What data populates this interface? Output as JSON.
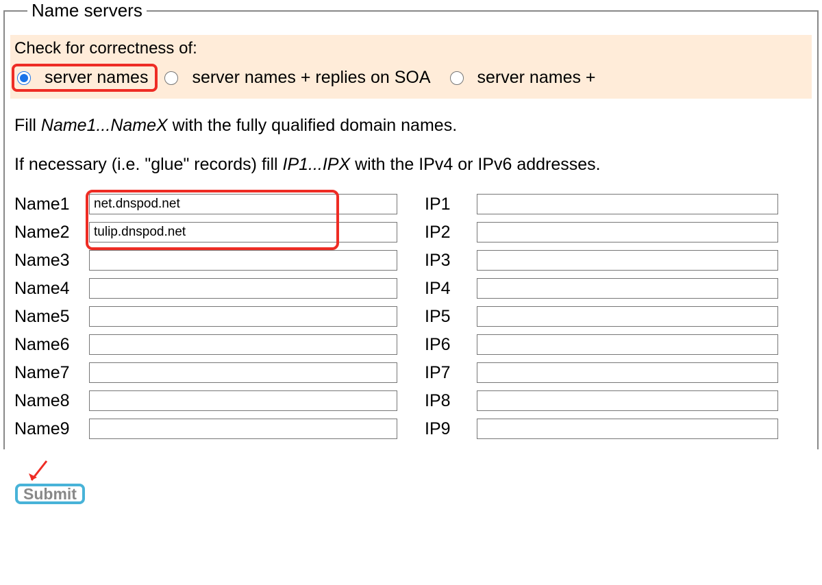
{
  "fieldset": {
    "legend": "Name servers",
    "check_label": "Check for correctness of:",
    "radios": {
      "opt1": "server names",
      "opt2": "server names + replies on SOA",
      "opt3": "server names +"
    },
    "instruction1_a": "Fill ",
    "instruction1_b": "Name1...NameX",
    "instruction1_c": " with the fully qualified domain names.",
    "instruction2_a": "If necessary (i.e. \"glue\" records) fill ",
    "instruction2_b": "IP1...IPX",
    "instruction2_c": " with the IPv4 or IPv6 addresses.",
    "rows": [
      {
        "name_label": "Name1",
        "name_value": "net.dnspod.net",
        "ip_label": "IP1",
        "ip_value": ""
      },
      {
        "name_label": "Name2",
        "name_value": "tulip.dnspod.net",
        "ip_label": "IP2",
        "ip_value": ""
      },
      {
        "name_label": "Name3",
        "name_value": "",
        "ip_label": "IP3",
        "ip_value": ""
      },
      {
        "name_label": "Name4",
        "name_value": "",
        "ip_label": "IP4",
        "ip_value": ""
      },
      {
        "name_label": "Name5",
        "name_value": "",
        "ip_label": "IP5",
        "ip_value": ""
      },
      {
        "name_label": "Name6",
        "name_value": "",
        "ip_label": "IP6",
        "ip_value": ""
      },
      {
        "name_label": "Name7",
        "name_value": "",
        "ip_label": "IP7",
        "ip_value": ""
      },
      {
        "name_label": "Name8",
        "name_value": "",
        "ip_label": "IP8",
        "ip_value": ""
      },
      {
        "name_label": "Name9",
        "name_value": "",
        "ip_label": "IP9",
        "ip_value": ""
      }
    ]
  },
  "submit": {
    "label": "Submit"
  }
}
